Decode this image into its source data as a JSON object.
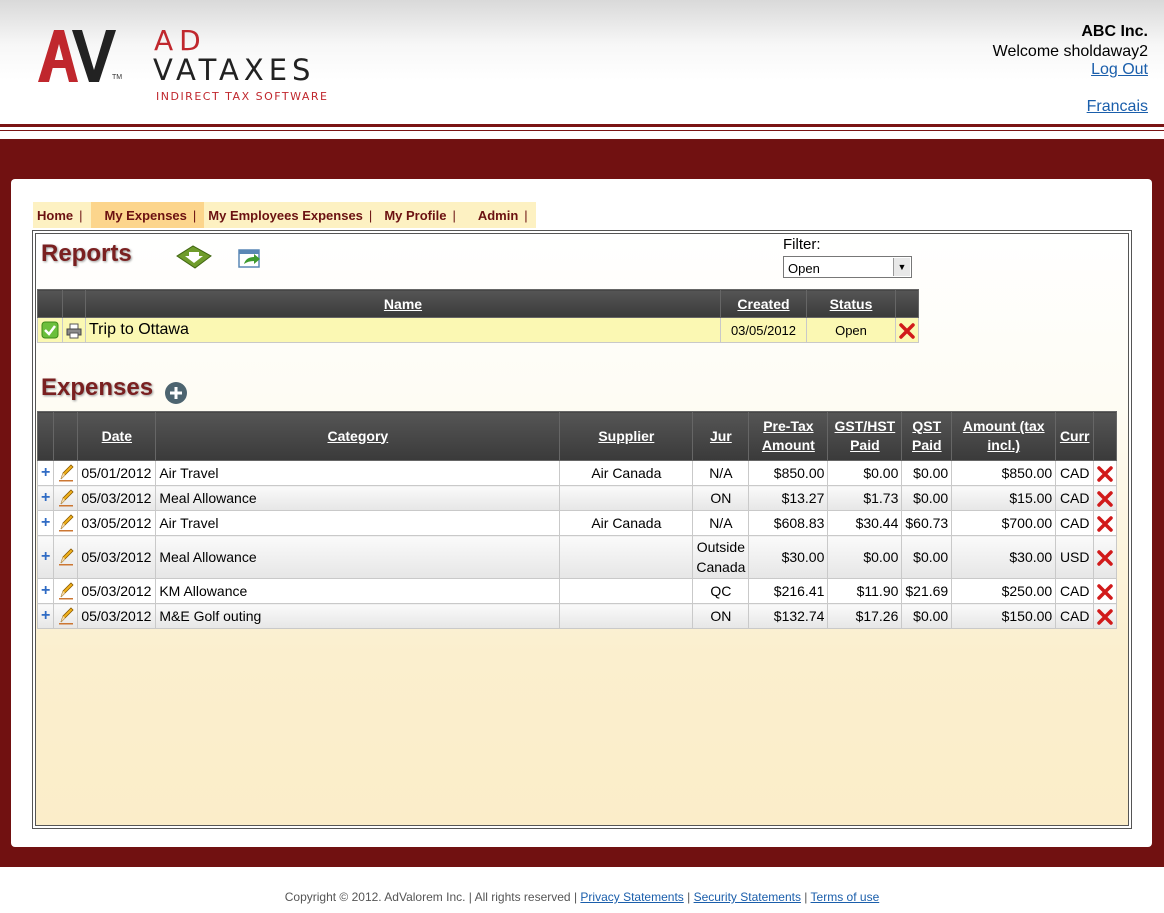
{
  "header": {
    "logo_ad": "AD",
    "logo_vataxes": "VATAXES",
    "logo_tagline": "INDIRECT TAX SOFTWARE",
    "logo_tm": "TM",
    "company": "ABC Inc.",
    "welcome": "Welcome sholdaway2",
    "logout": "Log Out",
    "language": "Francais"
  },
  "tabs": [
    {
      "label": "Home",
      "active": false
    },
    {
      "label": "My Expenses",
      "active": true
    },
    {
      "label": "My Employees Expenses",
      "active": false
    },
    {
      "label": "My Profile",
      "active": false
    },
    {
      "label": "Admin",
      "active": false
    }
  ],
  "reports": {
    "title": "Reports",
    "filter_label": "Filter:",
    "filter_value": "Open",
    "columns": [
      "Name",
      "Created",
      "Status"
    ],
    "rows": [
      {
        "name": "Trip to Ottawa",
        "created": "03/05/2012",
        "status": "Open"
      }
    ]
  },
  "expenses": {
    "title": "Expenses",
    "columns": [
      "Date",
      "Category",
      "Supplier",
      "Jur",
      "Pre-Tax Amount",
      "GST/HST Paid",
      "QST Paid",
      "Amount (tax incl.)",
      "Curr"
    ],
    "rows": [
      {
        "date": "05/01/2012",
        "category": "Air Travel",
        "supplier": "Air Canada",
        "jur": "N/A",
        "pretax": "$850.00",
        "gst": "$0.00",
        "qst": "$0.00",
        "amount": "$850.00",
        "curr": "CAD"
      },
      {
        "date": "05/03/2012",
        "category": "Meal Allowance",
        "supplier": "",
        "jur": "ON",
        "pretax": "$13.27",
        "gst": "$1.73",
        "qst": "$0.00",
        "amount": "$15.00",
        "curr": "CAD"
      },
      {
        "date": "03/05/2012",
        "category": "Air Travel",
        "supplier": "Air Canada",
        "jur": "N/A",
        "pretax": "$608.83",
        "gst": "$30.44",
        "qst": "$60.73",
        "amount": "$700.00",
        "curr": "CAD"
      },
      {
        "date": "05/03/2012",
        "category": "Meal Allowance",
        "supplier": "",
        "jur": "Outside Canada",
        "pretax": "$30.00",
        "gst": "$0.00",
        "qst": "$0.00",
        "amount": "$30.00",
        "curr": "USD"
      },
      {
        "date": "05/03/2012",
        "category": "KM Allowance",
        "supplier": "",
        "jur": "QC",
        "pretax": "$216.41",
        "gst": "$11.90",
        "qst": "$21.69",
        "amount": "$250.00",
        "curr": "CAD"
      },
      {
        "date": "05/03/2012",
        "category": "M&E Golf outing",
        "supplier": "",
        "jur": "ON",
        "pretax": "$132.74",
        "gst": "$17.26",
        "qst": "$0.00",
        "amount": "$150.00",
        "curr": "CAD"
      }
    ]
  },
  "footer": {
    "copyright": "Copyright © 2012. AdValorem Inc. | All rights reserved |",
    "privacy": "Privacy Statements",
    "security": "Security Statements",
    "terms": "Terms of use"
  },
  "colors": {
    "brand_red": "#c0272d",
    "band": "#711111",
    "tab_text": "#6b1111",
    "link": "#1a5eab"
  }
}
